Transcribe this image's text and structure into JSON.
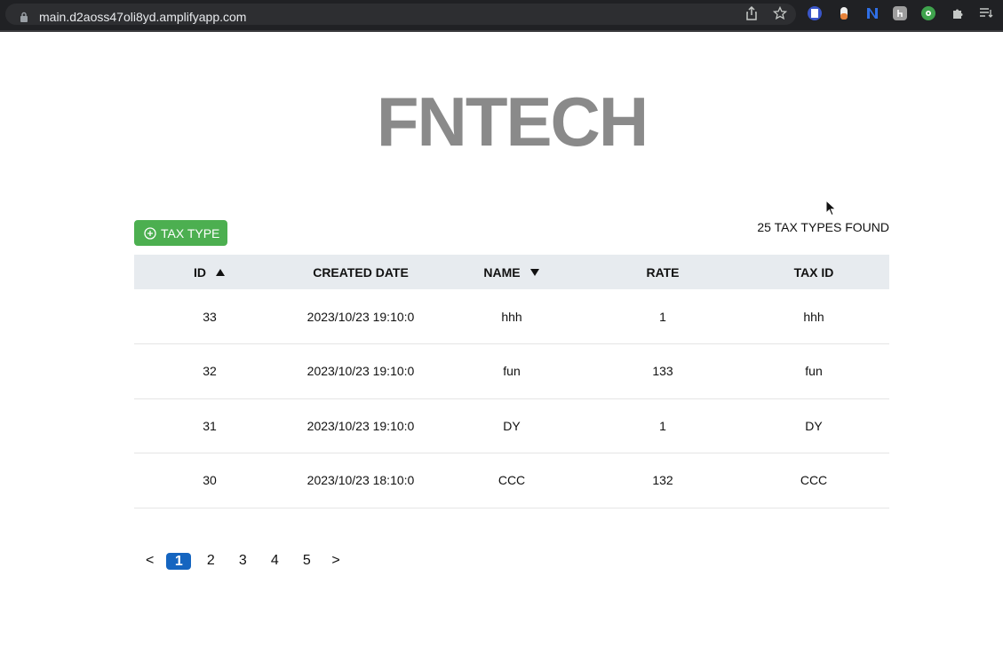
{
  "browser": {
    "url": "main.d2aoss47oli8yd.amplifyapp.com",
    "toolbar_icons": [
      "share-icon",
      "bookmark-star-icon"
    ],
    "extension_icons": [
      "extension-blue-doc-icon",
      "extension-pill-icon",
      "extension-n-icon",
      "extension-gray-icon",
      "extension-green-icon",
      "puzzle-icon",
      "reading-list-icon"
    ]
  },
  "page": {
    "logo": "FNTECH",
    "add_button_label": "TAX TYPE",
    "found_count": "25 TAX TYPES FOUND"
  },
  "table": {
    "headers": {
      "id": "ID",
      "created_date": "CREATED DATE",
      "name": "NAME",
      "rate": "RATE",
      "tax_id": "TAX ID"
    },
    "sort": {
      "id": "ascending",
      "name": "descending"
    },
    "rows": [
      {
        "id": "33",
        "created_date": "2023/10/23 19:10:0",
        "name": "hhh",
        "rate": "1",
        "tax_id": "hhh"
      },
      {
        "id": "32",
        "created_date": "2023/10/23 19:10:0",
        "name": "fun",
        "rate": "133",
        "tax_id": "fun"
      },
      {
        "id": "31",
        "created_date": "2023/10/23 19:10:0",
        "name": "DY",
        "rate": "1",
        "tax_id": "DY"
      },
      {
        "id": "30",
        "created_date": "2023/10/23 18:10:0",
        "name": "CCC",
        "rate": "132",
        "tax_id": "CCC"
      }
    ]
  },
  "pagination": {
    "prev": "<",
    "next": ">",
    "pages": [
      "1",
      "2",
      "3",
      "4",
      "5"
    ],
    "current": "1"
  },
  "colors": {
    "add_button": "#4caf50",
    "active_page": "#1565c0",
    "logo": "#8a8a8a",
    "table_header_bg": "#e7ebef"
  }
}
